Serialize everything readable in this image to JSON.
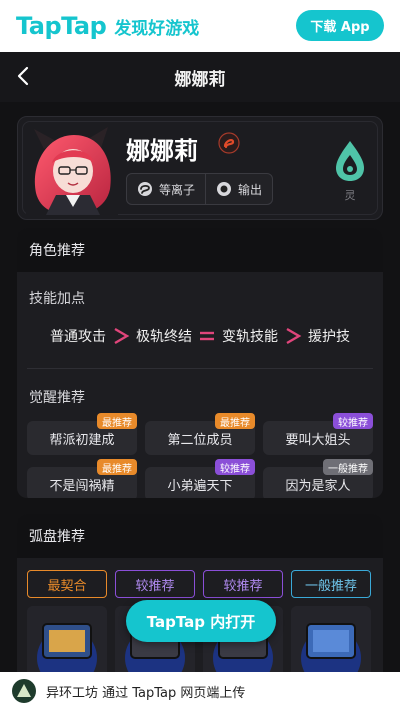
{
  "topbar": {
    "logo": "TapTap",
    "slogan": "发现好游戏",
    "download_label": "下载 App"
  },
  "nav": {
    "title": "娜娜莉"
  },
  "hero": {
    "name": "娜娜莉",
    "tags": [
      {
        "icon": "plasma-icon",
        "label": "等离子"
      },
      {
        "icon": "dps-icon",
        "label": "输出"
      }
    ],
    "element_label": "灵",
    "element_color": "#4fc4a8"
  },
  "role": {
    "title": "角色推荐",
    "skills_title": "技能加点",
    "skills": [
      {
        "label": "普通攻击",
        "sep": ">"
      },
      {
        "label": "极轨终结",
        "sep": "="
      },
      {
        "label": "变轨技能",
        "sep": ">"
      },
      {
        "label": "援护技",
        "sep": ""
      }
    ],
    "awaken_title": "觉醒推荐",
    "awaken": [
      {
        "label": "帮派初建成",
        "badge": "最推荐",
        "badge_color": "#e88a2a"
      },
      {
        "label": "第二位成员",
        "badge": "最推荐",
        "badge_color": "#e88a2a"
      },
      {
        "label": "要叫大姐头",
        "badge": "较推荐",
        "badge_color": "#8b4fd8"
      },
      {
        "label": "不是闯祸精",
        "badge": "最推荐",
        "badge_color": "#e88a2a"
      },
      {
        "label": "小弟遍天下",
        "badge": "较推荐",
        "badge_color": "#8b4fd8"
      },
      {
        "label": "因为是家人",
        "badge": "一般推荐",
        "badge_color": "#6f6f76"
      }
    ]
  },
  "arc": {
    "title": "弧盘推荐",
    "buttons": [
      {
        "label": "最契合",
        "color": "#e88a2a"
      },
      {
        "label": "较推荐",
        "color": "#8b4fd8"
      },
      {
        "label": "较推荐",
        "color": "#8b4fd8"
      },
      {
        "label": "一般推荐",
        "color": "#3aa9d8"
      }
    ]
  },
  "float_button": {
    "label": "TapTap 内打开"
  },
  "footer": {
    "text": "异环工坊 通过 TapTap 网页端上传"
  }
}
